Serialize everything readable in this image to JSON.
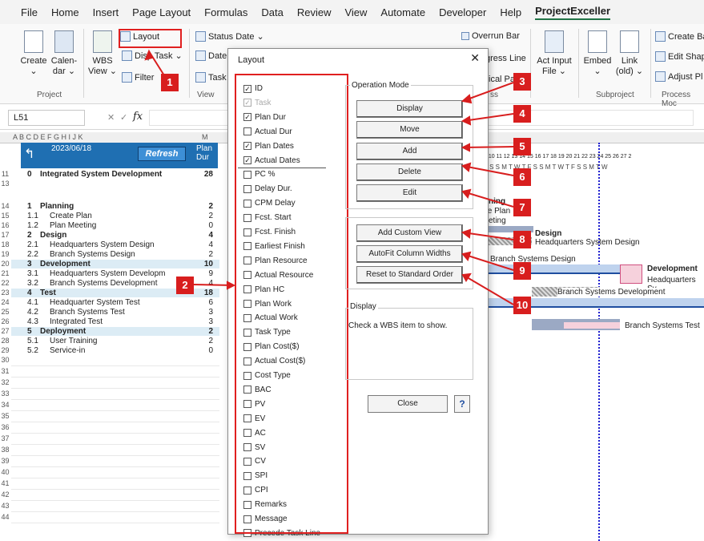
{
  "menu": {
    "items": [
      "File",
      "Home",
      "Insert",
      "Page Layout",
      "Formulas",
      "Data",
      "Review",
      "View",
      "Automate",
      "Developer",
      "Help",
      "ProjectExceller"
    ],
    "active": "ProjectExceller"
  },
  "ribbon": {
    "create": "Create",
    "calendar": [
      "Calen-",
      "dar"
    ],
    "project_group": "Project",
    "wbs": [
      "WBS",
      "View"
    ],
    "layout": "Layout",
    "display_task": "Disp Task",
    "filter": "Filter",
    "status_date": "Status Date",
    "date": "Date",
    "task": "Task",
    "view_group": "View",
    "overrun_bar": "Overrun Bar",
    "progress_line": "gress Line",
    "critical_path": "ical Pa",
    "ss_group": "ss",
    "act_input": [
      "Act Input",
      "File"
    ],
    "embed": "Embed",
    "link": [
      "Link",
      "(old)"
    ],
    "subproject_group": "Subproject",
    "create_ba": "Create Ba",
    "edit_shap": "Edit Shap",
    "adjust_pl": "Adjust Pl",
    "process_group": "Process Moc"
  },
  "formula": {
    "cell": "L51",
    "fx": "fx"
  },
  "sheet": {
    "cols": "A B C D E F G H I J K",
    "status_date": "2023/06/18",
    "refresh": "Refresh",
    "plan_dur_header": [
      "Plan",
      "Dur"
    ],
    "rows": [
      {
        "num": "11",
        "id": "0",
        "name": "Integrated System Development",
        "dur": "28",
        "style": "top"
      },
      {
        "num": "13",
        "id": "",
        "name": "",
        "dur": "",
        "style": ""
      },
      {
        "num": "14",
        "id": "1",
        "name": "Planning",
        "dur": "2",
        "style": "top"
      },
      {
        "num": "15",
        "id": "1.1",
        "name": "Create Plan",
        "dur": "2",
        "style": ""
      },
      {
        "num": "16",
        "id": "1.2",
        "name": "Plan Meeting",
        "dur": "0",
        "style": ""
      },
      {
        "num": "17",
        "id": "2",
        "name": "Design",
        "dur": "4",
        "style": "top"
      },
      {
        "num": "18",
        "id": "2.1",
        "name": "Headquarters System Design",
        "dur": "4",
        "style": ""
      },
      {
        "num": "19",
        "id": "2.2",
        "name": "Branch Systems Design",
        "dur": "2",
        "style": ""
      },
      {
        "num": "20",
        "id": "3",
        "name": "Development",
        "dur": "10",
        "style": "phase"
      },
      {
        "num": "21",
        "id": "3.1",
        "name": "Headquarters System Developm",
        "dur": "9",
        "style": ""
      },
      {
        "num": "22",
        "id": "3.2",
        "name": "Branch Systems Development",
        "dur": "4",
        "style": ""
      },
      {
        "num": "23",
        "id": "4",
        "name": "Test",
        "dur": "18",
        "style": "phase"
      },
      {
        "num": "24",
        "id": "4.1",
        "name": "Headquarter System Test",
        "dur": "6",
        "style": ""
      },
      {
        "num": "25",
        "id": "4.2",
        "name": "Branch Systems Test",
        "dur": "3",
        "style": ""
      },
      {
        "num": "26",
        "id": "4.3",
        "name": "Integrated Test",
        "dur": "3",
        "style": ""
      },
      {
        "num": "27",
        "id": "5",
        "name": "Deployment",
        "dur": "2",
        "style": "phase"
      },
      {
        "num": "28",
        "id": "5.1",
        "name": "User Training",
        "dur": "2",
        "style": ""
      },
      {
        "num": "29",
        "id": "5.2",
        "name": "Service-in",
        "dur": "0",
        "style": ""
      }
    ],
    "empty_rows": [
      "30",
      "31",
      "32",
      "33",
      "34",
      "35",
      "36",
      "37",
      "38",
      "39",
      "40",
      "41",
      "42",
      "43",
      "44"
    ],
    "gantt_days": "9 10 11 12 13 14 15 16 17 18 19 20 21 22 23 24 25 26 27 2",
    "gantt_weekdays": "F S S M T W T F S S M T W T F S S M T W",
    "gantt_labels": [
      "ning",
      "te Plan",
      "eting",
      "Design",
      "Headquarters System Design",
      "Branch Systems Design",
      "Development",
      "Headquarters Sy",
      "Branch Systems Development",
      "Branch Systems Test"
    ]
  },
  "dialog": {
    "title": "Layout",
    "close_x": "✕",
    "items": [
      {
        "label": "ID",
        "checked": true,
        "disabled": false
      },
      {
        "label": "Task",
        "checked": true,
        "disabled": true
      },
      {
        "label": "Plan Dur",
        "checked": true,
        "disabled": false
      },
      {
        "label": "Actual Dur",
        "checked": false,
        "disabled": false
      },
      {
        "label": "Plan Dates",
        "checked": true,
        "disabled": false
      },
      {
        "label": "Actual Dates",
        "checked": true,
        "disabled": false
      },
      {
        "label": "PC %",
        "checked": false,
        "disabled": false
      },
      {
        "label": "Delay Dur.",
        "checked": false,
        "disabled": false
      },
      {
        "label": "CPM Delay",
        "checked": false,
        "disabled": false
      },
      {
        "label": "Fcst. Start",
        "checked": false,
        "disabled": false
      },
      {
        "label": "Fcst. Finish",
        "checked": false,
        "disabled": false
      },
      {
        "label": "Earliest Finish",
        "checked": false,
        "disabled": false
      },
      {
        "label": "Plan Resource",
        "checked": false,
        "disabled": false
      },
      {
        "label": "Actual Resource",
        "checked": false,
        "disabled": false
      },
      {
        "label": "Plan HC",
        "checked": false,
        "disabled": false
      },
      {
        "label": "Plan Work",
        "checked": false,
        "disabled": false
      },
      {
        "label": "Actual Work",
        "checked": false,
        "disabled": false
      },
      {
        "label": "Task Type",
        "checked": false,
        "disabled": false
      },
      {
        "label": "Plan Cost($)",
        "checked": false,
        "disabled": false
      },
      {
        "label": "Actual Cost($)",
        "checked": false,
        "disabled": false
      },
      {
        "label": "Cost Type",
        "checked": false,
        "disabled": false
      },
      {
        "label": "BAC",
        "checked": false,
        "disabled": false
      },
      {
        "label": "PV",
        "checked": false,
        "disabled": false
      },
      {
        "label": "EV",
        "checked": false,
        "disabled": false
      },
      {
        "label": "AC",
        "checked": false,
        "disabled": false
      },
      {
        "label": "SV",
        "checked": false,
        "disabled": false
      },
      {
        "label": "CV",
        "checked": false,
        "disabled": false
      },
      {
        "label": "SPI",
        "checked": false,
        "disabled": false
      },
      {
        "label": "CPI",
        "checked": false,
        "disabled": false
      },
      {
        "label": "Remarks",
        "checked": false,
        "disabled": false
      },
      {
        "label": "Message",
        "checked": false,
        "disabled": false
      },
      {
        "label": "Precede Task Line",
        "checked": false,
        "disabled": false
      }
    ],
    "operation_mode": "Operation Mode",
    "mode_buttons": [
      "Display",
      "Move",
      "Add",
      "Delete",
      "Edit"
    ],
    "custom_buttons": [
      "Add Custom View",
      "AutoFit Column Widths",
      "Reset to Standard Order"
    ],
    "display_group": "Display",
    "display_hint": "Check a WBS item to show.",
    "close": "Close",
    "help": "?"
  },
  "markers": [
    "1",
    "2",
    "3",
    "4",
    "5",
    "6",
    "7",
    "8",
    "9",
    "10"
  ],
  "colors": {
    "accent": "#217346",
    "marker": "#d81e1e",
    "header": "#1f6fb2",
    "phase": "#dcecf5"
  }
}
